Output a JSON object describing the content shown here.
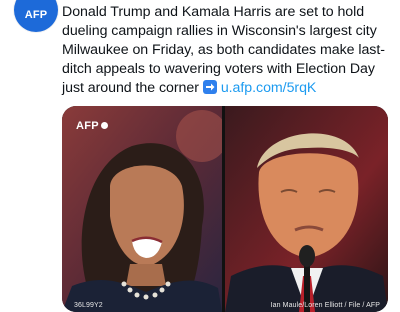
{
  "account": {
    "avatar_label": "AFP",
    "avatar_color": "#1d6ad9"
  },
  "tweet": {
    "text": "Donald Trump and Kamala Harris are set to hold dueling campaign rallies in Wisconsin's largest city Milwaukee on Friday, as both candidates make last-ditch appeals to wavering voters with Election Day just around the corner",
    "link_icon": "right-arrow-emoji-icon",
    "link_text": "u.afp.com/5rqK",
    "link_color": "#1d9bf0"
  },
  "media": {
    "watermark": "AFP",
    "left_photo": {
      "subject_icon": "kamala-harris-photo",
      "credit": "36L99Y2"
    },
    "right_photo": {
      "subject_icon": "donald-trump-photo",
      "credit": "Ian Maule/Loren Elliott / File / AFP"
    }
  }
}
